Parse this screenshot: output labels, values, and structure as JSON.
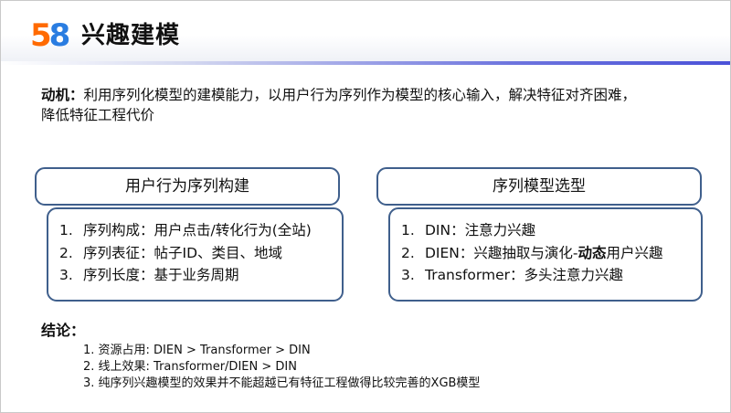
{
  "logo": {
    "digit1": "5",
    "digit2": "8"
  },
  "title": "兴趣建模",
  "motivation": {
    "label": "动机：",
    "text": "利用序列化模型的建模能力，以用户行为序列作为模型的核心输入，解决特征对齐困难，",
    "text2": "降低特征工程代价"
  },
  "left_box": {
    "title": "用户行为序列构建",
    "items": [
      {
        "num": "1.",
        "text": "序列构成：用户点击/转化行为(全站)"
      },
      {
        "num": "2.",
        "text": "序列表征：帖子ID、类目、地域"
      },
      {
        "num": "3.",
        "text": "序列长度：基于业务周期"
      }
    ]
  },
  "right_box": {
    "title": "序列模型选型",
    "items": [
      {
        "num": "1.",
        "text": "DIN：注意力兴趣"
      },
      {
        "num": "2.",
        "text_pre": "DIEN：兴趣抽取与演化-",
        "text_bold": "动态",
        "text_post": "用户兴趣"
      },
      {
        "num": "3.",
        "text": "Transformer：多头注意力兴趣"
      }
    ]
  },
  "conclusion": {
    "label": "结论：",
    "items": [
      "1. 资源占用: DIEN > Transformer > DIN",
      "2. 线上效果: Transformer/DIEN > DIN",
      "3. 纯序列兴趣模型的效果并不能超越已有特征工程做得比较完善的XGB模型"
    ]
  },
  "colors": {
    "box_border": "#3f5f8c",
    "header_line": "#4b52d8",
    "logo_orange": "#ff6a00",
    "logo_blue": "#2a7de1",
    "logo_green": "#33b34a"
  }
}
